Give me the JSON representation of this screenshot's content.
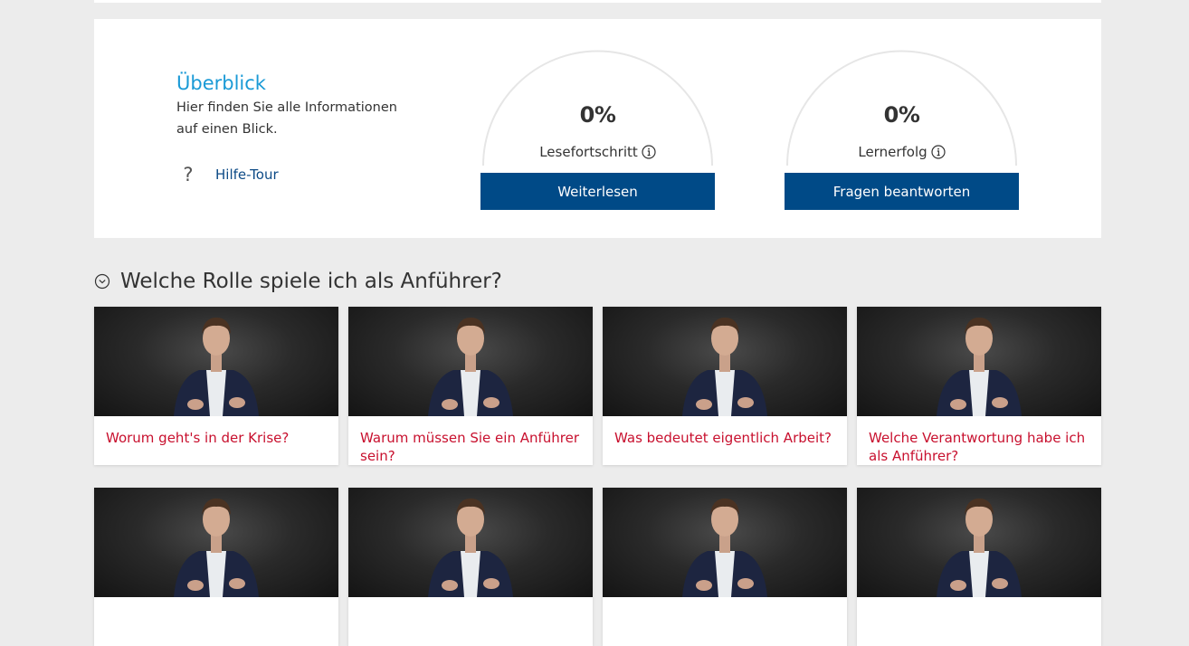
{
  "overview": {
    "title": "Überblick",
    "description": "Hier finden Sie alle Informationen auf einen Blick.",
    "help_icon": "question-mark-icon",
    "help_label": "Hilfe-Tour"
  },
  "gauges": [
    {
      "percent_text": "0%",
      "label": "Lesefortschritt",
      "info_icon": "info-icon",
      "button_label": "Weiterlesen",
      "value": 0
    },
    {
      "percent_text": "0%",
      "label": "Lernerfolg",
      "info_icon": "info-icon",
      "button_label": "Fragen beantworten",
      "value": 0
    }
  ],
  "section": {
    "icon": "chevron-down-circle-icon",
    "title": "Welche Rolle spiele ich als Anführer?",
    "cards": [
      {
        "title": "Worum geht's in der Krise?"
      },
      {
        "title": "Warum müssen Sie ein Anführer sein?"
      },
      {
        "title": "Was bedeutet eigentlich Arbeit?"
      },
      {
        "title": "Welche Verantwortung habe ich als Anführer?"
      },
      {
        "title": ""
      },
      {
        "title": ""
      },
      {
        "title": ""
      },
      {
        "title": ""
      }
    ]
  },
  "colors": {
    "accent_blue": "#1a9ad6",
    "button_blue": "#004a87",
    "link_blue": "#0c4a86",
    "card_title_red": "#c8102e",
    "page_bg": "#ececec"
  }
}
